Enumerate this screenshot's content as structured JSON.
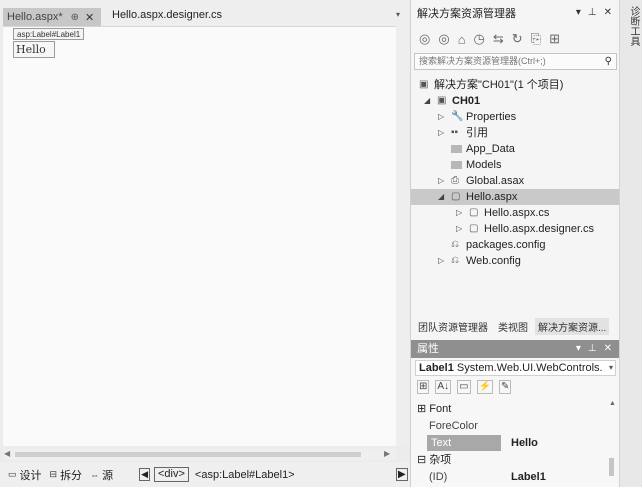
{
  "editor": {
    "tabs": [
      {
        "label": "Hello.aspx*",
        "pin": "⊕",
        "close": "✕"
      },
      {
        "label": "Hello.aspx.designer.cs"
      }
    ],
    "dropdown_glyph": "▾",
    "control_tag": "asp:Label#Label1",
    "label_text": "Hello"
  },
  "status": {
    "design": {
      "icon": "▭",
      "label": "设计"
    },
    "split": {
      "icon": "⊟",
      "label": "拆分"
    },
    "source": {
      "icon": "⇔",
      "label": "源"
    },
    "crumb_left": "◀",
    "crumb_div": "<div>",
    "crumb_label": "<asp:Label#Label1>",
    "crumb_right": "▶"
  },
  "solution_explorer": {
    "title": "解决方案资源管理器",
    "controls": [
      "▾",
      "⊥",
      "✕"
    ],
    "toolbar_icons": [
      "◎",
      "◎",
      "⌂",
      "◷",
      "⇆",
      "↻",
      "⎘",
      "⊞"
    ],
    "search_placeholder": "搜索解决方案资源管理器(Ctrl+;)",
    "search_icon": "⚲",
    "tree": [
      {
        "name": "solution",
        "label": "解决方案\"CH01\"(1 个项目)",
        "exp": "",
        "icon": "▣",
        "indent": 0,
        "bold": false
      },
      {
        "name": "project-ch01",
        "label": "CH01",
        "exp": "◢",
        "icon": "▣",
        "indent": 1,
        "bold": true
      },
      {
        "name": "properties",
        "label": "Properties",
        "exp": "▷",
        "icon": "🔧",
        "indent": 2,
        "bold": false
      },
      {
        "name": "references",
        "label": "引用",
        "exp": "▷",
        "icon": "▪▪",
        "indent": 2,
        "bold": false
      },
      {
        "name": "app-data",
        "label": "App_Data",
        "exp": "",
        "icon": "folder",
        "indent": 2,
        "bold": false
      },
      {
        "name": "models",
        "label": "Models",
        "exp": "",
        "icon": "folder",
        "indent": 2,
        "bold": false
      },
      {
        "name": "global-asax",
        "label": "Global.asax",
        "exp": "▷",
        "icon": "⎙",
        "indent": 2,
        "bold": false
      },
      {
        "name": "hello-aspx",
        "label": "Hello.aspx",
        "exp": "◢",
        "icon": "▢",
        "indent": 2,
        "bold": false,
        "selected": true
      },
      {
        "name": "hello-aspx-cs",
        "label": "Hello.aspx.cs",
        "exp": "▷",
        "icon": "▢",
        "indent": 3,
        "bold": false
      },
      {
        "name": "hello-aspx-designer-cs",
        "label": "Hello.aspx.designer.cs",
        "exp": "▷",
        "icon": "▢",
        "indent": 3,
        "bold": false
      },
      {
        "name": "packages-config",
        "label": "packages.config",
        "exp": "",
        "icon": "⎌",
        "indent": 2,
        "bold": false
      },
      {
        "name": "web-config",
        "label": "Web.config",
        "exp": "▷",
        "icon": "⎌",
        "indent": 2,
        "bold": false
      }
    ],
    "bottom_tabs": [
      "团队资源管理器",
      "类视图",
      "解决方案资源..."
    ]
  },
  "properties": {
    "title": "属性",
    "controls": [
      "▾",
      "⊥",
      "✕"
    ],
    "object_name": "Label1",
    "object_type": "System.Web.UI.WebControls.",
    "tool_icons": [
      "⊞",
      "A↓",
      "▭",
      "⚡",
      "✎"
    ],
    "rows": [
      {
        "kind": "cat",
        "name": "⊞ Font",
        "value": ""
      },
      {
        "kind": "prop",
        "name": "ForeColor",
        "value": ""
      },
      {
        "kind": "prop",
        "name": "Text",
        "value": "Hello",
        "selected": true
      },
      {
        "kind": "cat",
        "name": "⊟ 杂项",
        "value": ""
      },
      {
        "kind": "prop",
        "name": "(ID)",
        "value": "Label1"
      }
    ]
  },
  "side_strip": {
    "label": "诊断工具"
  }
}
